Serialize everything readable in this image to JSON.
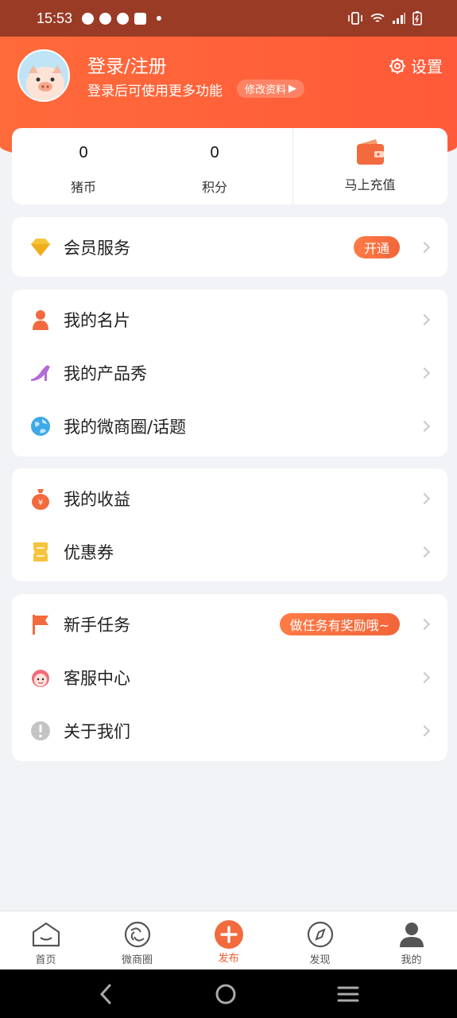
{
  "status_bar": {
    "time": "15:53"
  },
  "profile": {
    "login_title": "登录/注册",
    "login_subtitle": "登录后可使用更多功能",
    "edit_profile": "修改资料",
    "settings_label": "设置"
  },
  "stats": {
    "coins_value": "0",
    "coins_label": "猪币",
    "points_value": "0",
    "points_label": "积分",
    "recharge_label": "马上充值"
  },
  "membership": {
    "label": "会员服务",
    "badge": "开通"
  },
  "group1": [
    {
      "label": "我的名片",
      "icon": "person-icon"
    },
    {
      "label": "我的产品秀",
      "icon": "high-heel-icon"
    },
    {
      "label": "我的微商圈/话题",
      "icon": "globe-icon"
    }
  ],
  "group2": [
    {
      "label": "我的收益",
      "icon": "money-bag-icon"
    },
    {
      "label": "优惠券",
      "icon": "coupon-icon"
    }
  ],
  "group3": [
    {
      "label": "新手任务",
      "icon": "flag-icon",
      "badge": "做任务有奖励哦~"
    },
    {
      "label": "客服中心",
      "icon": "customer-service-icon"
    },
    {
      "label": "关于我们",
      "icon": "info-icon"
    }
  ],
  "bottom_nav": [
    {
      "label": "首页",
      "icon": "home-icon",
      "active": false
    },
    {
      "label": "微商圈",
      "icon": "circle-icon",
      "active": false
    },
    {
      "label": "发布",
      "icon": "plus-icon",
      "active": true
    },
    {
      "label": "发现",
      "icon": "compass-icon",
      "active": false
    },
    {
      "label": "我的",
      "icon": "user-icon",
      "active": false
    }
  ],
  "colors": {
    "accent": "#ff5f39",
    "badge": "#f2653a",
    "background": "#f2f3f7"
  }
}
